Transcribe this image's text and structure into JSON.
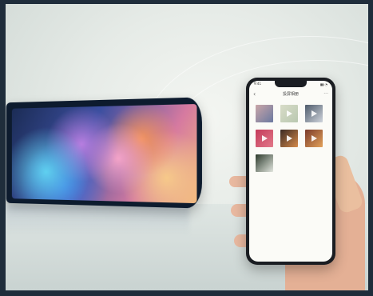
{
  "phone": {
    "app_title": "投屏相册",
    "status_time": "9:41",
    "status_icons": "▮▮ ◔",
    "back_icon": "‹",
    "more_icon": "···",
    "thumbnails": [
      {
        "name": "thumb-1",
        "colors": [
          "#caa6a8",
          "#6a78a0"
        ],
        "has_play": false
      },
      {
        "name": "thumb-2",
        "colors": [
          "#d8dcc8",
          "#b9c8b0"
        ],
        "has_play": true
      },
      {
        "name": "thumb-3",
        "colors": [
          "#4d5a6a",
          "#cfd4dc"
        ],
        "has_play": true
      },
      {
        "name": "thumb-4",
        "colors": [
          "#c43a5a",
          "#e27a8a"
        ],
        "has_play": true
      },
      {
        "name": "thumb-5",
        "colors": [
          "#3a2a24",
          "#d58a4a"
        ],
        "has_play": true
      },
      {
        "name": "thumb-6",
        "colors": [
          "#7a3a2a",
          "#e3a25a"
        ],
        "has_play": true
      },
      {
        "name": "thumb-7",
        "colors": [
          "#2c3a2c",
          "#e2e6de"
        ],
        "has_play": false
      }
    ]
  }
}
